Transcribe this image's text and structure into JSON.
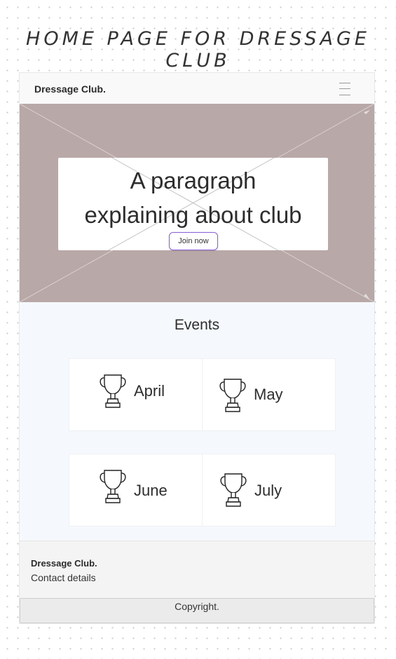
{
  "page_heading": "HOME PAGE FOR DRESSAGE CLUB",
  "navbar": {
    "brand": "Dressage Club.",
    "menu_icon": "hamburger-menu-icon"
  },
  "hero": {
    "paragraph_line1": "A paragraph",
    "paragraph_line2": "explaining about club",
    "join_button": "Join now",
    "image_placeholder": "image-placeholder-icon"
  },
  "events": {
    "title": "Events",
    "icon": "trophy-icon",
    "items": [
      {
        "label": "April"
      },
      {
        "label": "May"
      },
      {
        "label": "June"
      },
      {
        "label": "July"
      }
    ]
  },
  "footer": {
    "brand": "Dressage Club.",
    "contact": "Contact details",
    "copyright": "Copyright."
  },
  "colors": {
    "hero_background": "#b8a8a7",
    "button_border": "#8b5fd6",
    "events_background": "#f5f9fd",
    "footer_background": "#f4f4f4"
  }
}
